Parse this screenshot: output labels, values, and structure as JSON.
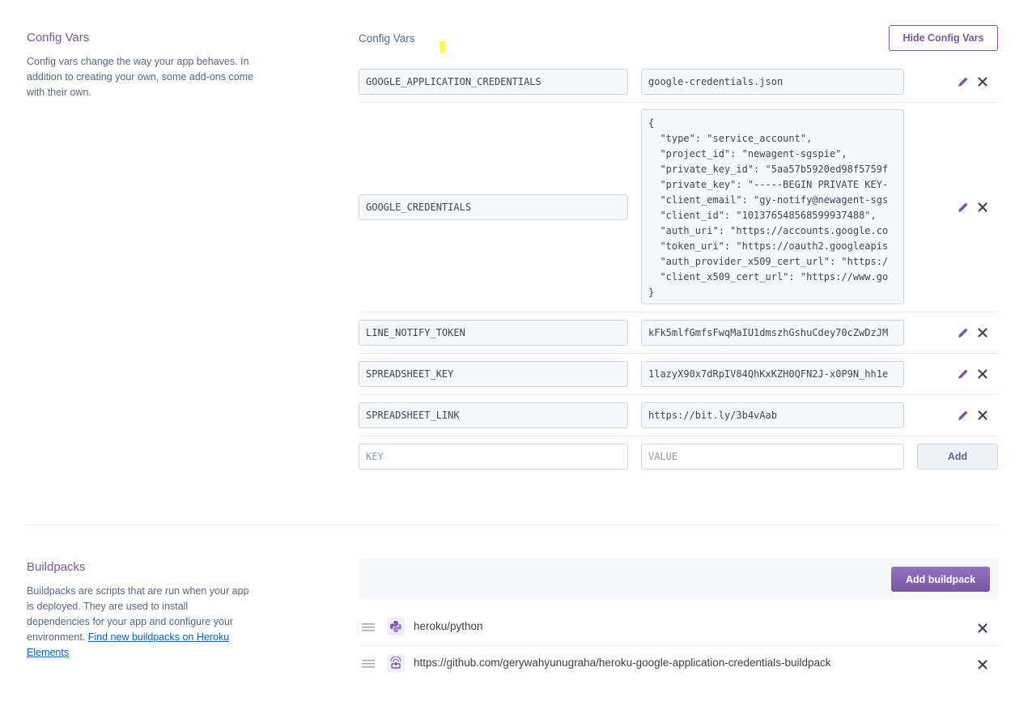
{
  "config_vars_section": {
    "title": "Config Vars",
    "description": "Config vars change the way your app behaves. In addition to creating your own, some add-ons come with their own.",
    "header_label": "Config Vars",
    "toggle_button": "Hide Config Vars",
    "vars": [
      {
        "key": "GOOGLE_APPLICATION_CREDENTIALS",
        "value": "google-credentials.json"
      },
      {
        "key": "GOOGLE_CREDENTIALS",
        "value": "{\n  \"type\": \"service_account\",\n  \"project_id\": \"newagent-sgspie\",\n  \"private_key_id\": \"5aa57b5920ed98f5759f\n  \"private_key\": \"-----BEGIN PRIVATE KEY-\n  \"client_email\": \"gy-notify@newagent-sgs\n  \"client_id\": \"101376548568599937488\",\n  \"auth_uri\": \"https://accounts.google.co\n  \"token_uri\": \"https://oauth2.googleapis\n  \"auth_provider_x509_cert_url\": \"https:/\n  \"client_x509_cert_url\": \"https://www.go\n}"
      },
      {
        "key": "LINE_NOTIFY_TOKEN",
        "value": "kFk5mlfGmfsFwqMaIU1dmszhGshuCdey70cZwDzJM"
      },
      {
        "key": "SPREADSHEET_KEY",
        "value": "1lazyX90x7dRpIV84QhKxKZH0QFN2J-x0P9N_hh1e"
      },
      {
        "key": "SPREADSHEET_LINK",
        "value": "https://bit.ly/3b4vAab"
      }
    ],
    "new_var": {
      "key_placeholder": "KEY",
      "value_placeholder": "VALUE",
      "add_label": "Add"
    }
  },
  "buildpacks_section": {
    "title": "Buildpacks",
    "description": "Buildpacks are scripts that are run when your app is deployed. They are used to install dependencies for your app and configure your environment.",
    "link_text": "Find new buildpacks on Heroku Elements",
    "add_button": "Add buildpack",
    "items": [
      {
        "name": "heroku/python",
        "icon": "python-icon"
      },
      {
        "name": "https://github.com/gerywahyunugraha/heroku-google-application-credentials-buildpack",
        "icon": "buildpack-generic-icon"
      }
    ]
  },
  "colors": {
    "accent": "#79589f",
    "link": "#0062d1",
    "highlight": "#ffff33"
  }
}
